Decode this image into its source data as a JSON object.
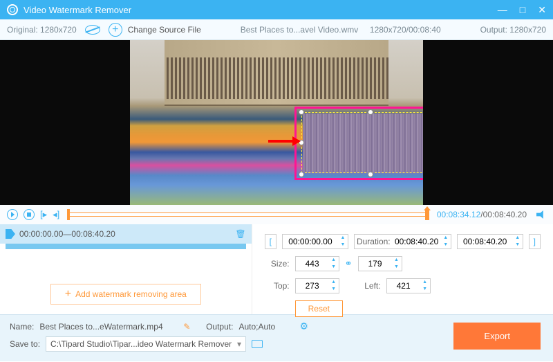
{
  "titlebar": {
    "title": "Video Watermark Remover"
  },
  "infobar": {
    "original": "Original: 1280x720",
    "change_source": "Change Source File",
    "filename": "Best Places to...avel Video.wmv",
    "fileinfo": "1280x720/00:08:40",
    "output": "Output: 1280x720"
  },
  "playbar": {
    "current": "00:08:34.12",
    "total": "/00:08:40.20"
  },
  "segment": {
    "start": "00:00:00.00",
    "sep": " — ",
    "end": "00:08:40.20"
  },
  "add_area": "Add watermark removing area",
  "controls": {
    "time_start": "00:00:00.00",
    "duration_label": "Duration:",
    "duration": "00:08:40.20",
    "time_end": "00:08:40.20",
    "size_label": "Size:",
    "width": "443",
    "height": "179",
    "top_label": "Top:",
    "top": "273",
    "left_label": "Left:",
    "left": "421",
    "reset": "Reset"
  },
  "bottom": {
    "name_label": "Name:",
    "name": "Best Places to...eWatermark.mp4",
    "output_label": "Output:",
    "output": "Auto;Auto",
    "save_label": "Save to:",
    "save_path": "C:\\Tipard Studio\\Tipar...ideo Watermark Remover",
    "export": "Export"
  }
}
